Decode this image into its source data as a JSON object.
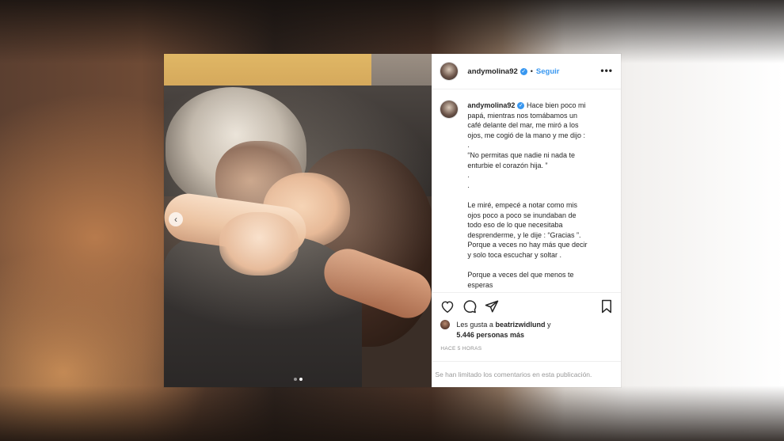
{
  "post": {
    "username": "andymolina92",
    "follow_label": "Seguir",
    "separator": "•",
    "more_icon_glyph": "•••",
    "caption_lines": [
      "Hace bien poco mi",
      "papá, mientras nos tomábamos un",
      "café delante del mar, me miró a los",
      "ojos, me cogió de la mano y me dijo :",
      ".",
      "“No permitas que nadie ni nada te",
      "enturbie el corazón hija. ”",
      ".",
      ".",
      "",
      "Le miré, empecé a notar como mis",
      "ojos poco a poco se inundaban de",
      "todo eso de lo que necesitaba",
      "desprenderme, y le dije : “Gracias ”.",
      "Porque a veces no hay más que decir",
      "y solo toca escuchar y soltar .",
      "",
      "Porque a veces del que menos te",
      "esperas"
    ],
    "likes_prefix": "Les gusta a",
    "likes_user": "beatrizwidlund",
    "likes_conj": "y",
    "likes_count": "5.446 personas más",
    "timestamp": "HACE 5 HORAS",
    "comments_limited": "Se han limitado los comentarios en esta publicación.",
    "carousel": {
      "current": 2,
      "total": 2,
      "prev_glyph": "‹"
    },
    "verified_glyph": "✓"
  },
  "icons": {
    "heart": "heart-icon",
    "comment": "comment-icon",
    "share": "share-icon",
    "bookmark": "bookmark-icon",
    "more": "more-icon",
    "verified": "verified-icon"
  },
  "colors": {
    "accent": "#3897f0",
    "text": "#262626",
    "muted": "#8e8e8e"
  }
}
